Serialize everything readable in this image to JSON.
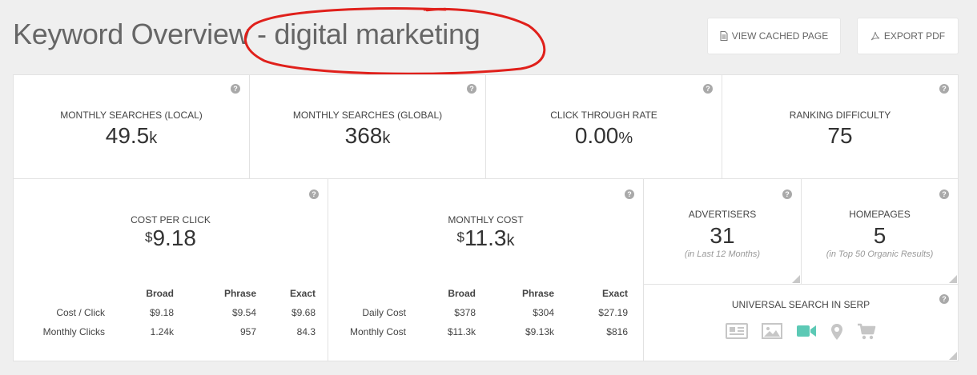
{
  "header": {
    "title": "Keyword Overview - digital marketing",
    "view_cached_label": "VIEW CACHED PAGE",
    "export_pdf_label": "EXPORT PDF"
  },
  "stats": {
    "local": {
      "label": "MONTHLY SEARCHES (LOCAL)",
      "value": "49.5",
      "suffix": "k"
    },
    "global": {
      "label": "MONTHLY SEARCHES (GLOBAL)",
      "value": "368",
      "suffix": "k"
    },
    "ctr": {
      "label": "CLICK THROUGH RATE",
      "value": "0.00",
      "suffix": "%"
    },
    "difficulty": {
      "label": "RANKING DIFFICULTY",
      "value": "75"
    }
  },
  "cpc": {
    "label": "COST PER CLICK",
    "currency": "$",
    "value": "9.18",
    "columns": [
      "Broad",
      "Phrase",
      "Exact"
    ],
    "rows": [
      {
        "label": "Cost / Click",
        "values": [
          "$9.18",
          "$9.54",
          "$9.68"
        ]
      },
      {
        "label": "Monthly Clicks",
        "values": [
          "1.24k",
          "957",
          "84.3"
        ]
      }
    ]
  },
  "monthly_cost": {
    "label": "MONTHLY COST",
    "currency": "$",
    "value": "11.3",
    "suffix": "k",
    "columns": [
      "Broad",
      "Phrase",
      "Exact"
    ],
    "rows": [
      {
        "label": "Daily Cost",
        "values": [
          "$378",
          "$304",
          "$27.19"
        ]
      },
      {
        "label": "Monthly Cost",
        "values": [
          "$11.3k",
          "$9.13k",
          "$816"
        ]
      }
    ]
  },
  "advertisers": {
    "label": "ADVERTISERS",
    "value": "31",
    "sub": "(in Last 12 Months)"
  },
  "homepages": {
    "label": "HOMEPAGES",
    "value": "5",
    "sub": "(in Top 50 Organic Results)"
  },
  "serp": {
    "label": "UNIVERSAL SEARCH IN SERP",
    "icons": [
      {
        "name": "news-icon",
        "active": false
      },
      {
        "name": "image-icon",
        "active": false
      },
      {
        "name": "video-icon",
        "active": true
      },
      {
        "name": "map-pin-icon",
        "active": false
      },
      {
        "name": "shopping-cart-icon",
        "active": false
      }
    ]
  },
  "help_symbol": "?",
  "colors": {
    "accent_active": "#5cc9b5",
    "inactive_icon": "#c6c6c6",
    "annotation": "#e0201b"
  }
}
